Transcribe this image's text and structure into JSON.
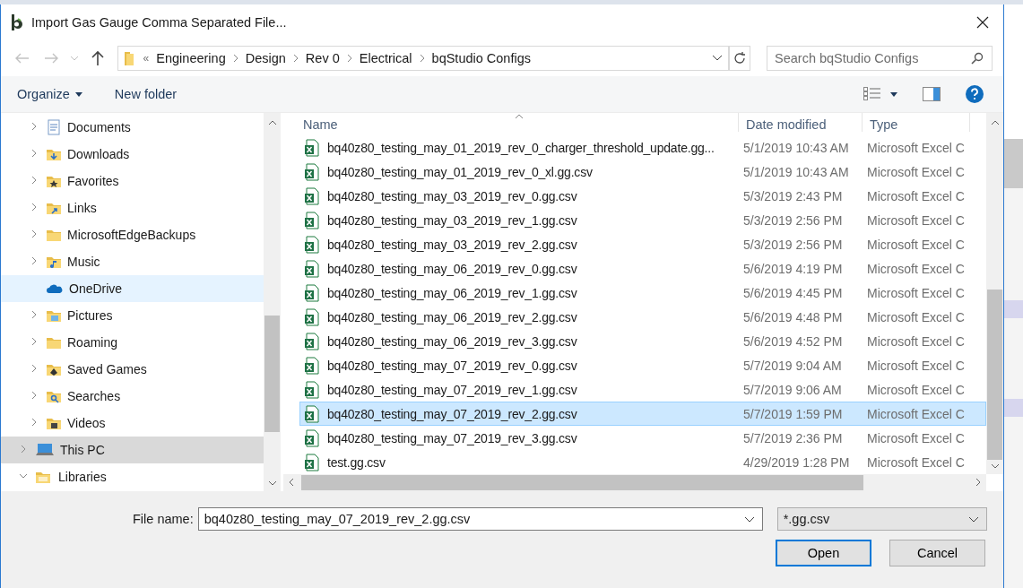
{
  "window": {
    "title": "Import Gas Gauge Comma Separated File..."
  },
  "address": {
    "overflow": "«",
    "crumbs": [
      "Engineering",
      "Design",
      "Rev 0",
      "Electrical",
      "bqStudio Configs"
    ]
  },
  "search": {
    "placeholder": "Search bqStudio Configs"
  },
  "toolbar": {
    "organize": "Organize",
    "new_folder": "New folder"
  },
  "nav": {
    "user_folders": [
      {
        "label": "Documents",
        "kind": "documents",
        "expandable": true,
        "expanded": false,
        "selected": false,
        "hovered": false
      },
      {
        "label": "Downloads",
        "kind": "downloads",
        "expandable": true,
        "expanded": false,
        "selected": false,
        "hovered": false
      },
      {
        "label": "Favorites",
        "kind": "favorites",
        "expandable": true,
        "expanded": false,
        "selected": false,
        "hovered": false
      },
      {
        "label": "Links",
        "kind": "links",
        "expandable": true,
        "expanded": false,
        "selected": false,
        "hovered": false
      },
      {
        "label": "MicrosoftEdgeBackups",
        "kind": "folder",
        "expandable": true,
        "expanded": false,
        "selected": false,
        "hovered": false
      },
      {
        "label": "Music",
        "kind": "music",
        "expandable": true,
        "expanded": false,
        "selected": false,
        "hovered": false
      },
      {
        "label": "OneDrive",
        "kind": "cloud",
        "expandable": false,
        "selected": false,
        "hovered": true
      },
      {
        "label": "Pictures",
        "kind": "pictures",
        "expandable": true,
        "expanded": false,
        "selected": false,
        "hovered": false
      },
      {
        "label": "Roaming",
        "kind": "folder",
        "expandable": true,
        "expanded": false,
        "selected": false,
        "hovered": false
      },
      {
        "label": "Saved Games",
        "kind": "games",
        "expandable": true,
        "expanded": false,
        "selected": false,
        "hovered": false
      },
      {
        "label": "Searches",
        "kind": "searches",
        "expandable": true,
        "expanded": false,
        "selected": false,
        "hovered": false
      },
      {
        "label": "Videos",
        "kind": "videos",
        "expandable": true,
        "expanded": false,
        "selected": false,
        "hovered": false
      }
    ],
    "roots": [
      {
        "label": "This PC",
        "kind": "pc",
        "expandable": true,
        "expanded": false,
        "selected": true,
        "hovered": false
      },
      {
        "label": "Libraries",
        "kind": "library",
        "expandable": true,
        "expanded": true,
        "selected": false,
        "hovered": false
      }
    ]
  },
  "files": {
    "columns": [
      "Name",
      "Date modified",
      "Type"
    ],
    "rows": [
      {
        "name": "bq40z80_testing_may_01_2019_rev_0_charger_threshold_update.gg...",
        "date": "5/1/2019 10:43 AM",
        "type": "Microsoft Excel C",
        "selected": false
      },
      {
        "name": "bq40z80_testing_may_01_2019_rev_0_xl.gg.csv",
        "date": "5/1/2019 10:43 AM",
        "type": "Microsoft Excel C",
        "selected": false
      },
      {
        "name": "bq40z80_testing_may_03_2019_rev_0.gg.csv",
        "date": "5/3/2019 2:43 PM",
        "type": "Microsoft Excel C",
        "selected": false
      },
      {
        "name": "bq40z80_testing_may_03_2019_rev_1.gg.csv",
        "date": "5/3/2019 2:56 PM",
        "type": "Microsoft Excel C",
        "selected": false
      },
      {
        "name": "bq40z80_testing_may_03_2019_rev_2.gg.csv",
        "date": "5/3/2019 2:56 PM",
        "type": "Microsoft Excel C",
        "selected": false
      },
      {
        "name": "bq40z80_testing_may_06_2019_rev_0.gg.csv",
        "date": "5/6/2019 4:19 PM",
        "type": "Microsoft Excel C",
        "selected": false
      },
      {
        "name": "bq40z80_testing_may_06_2019_rev_1.gg.csv",
        "date": "5/6/2019 4:45 PM",
        "type": "Microsoft Excel C",
        "selected": false
      },
      {
        "name": "bq40z80_testing_may_06_2019_rev_2.gg.csv",
        "date": "5/6/2019 4:48 PM",
        "type": "Microsoft Excel C",
        "selected": false
      },
      {
        "name": "bq40z80_testing_may_06_2019_rev_3.gg.csv",
        "date": "5/6/2019 4:52 PM",
        "type": "Microsoft Excel C",
        "selected": false
      },
      {
        "name": "bq40z80_testing_may_07_2019_rev_0.gg.csv",
        "date": "5/7/2019 9:04 AM",
        "type": "Microsoft Excel C",
        "selected": false
      },
      {
        "name": "bq40z80_testing_may_07_2019_rev_1.gg.csv",
        "date": "5/7/2019 9:06 AM",
        "type": "Microsoft Excel C",
        "selected": false
      },
      {
        "name": "bq40z80_testing_may_07_2019_rev_2.gg.csv",
        "date": "5/7/2019 1:59 PM",
        "type": "Microsoft Excel C",
        "selected": true
      },
      {
        "name": "bq40z80_testing_may_07_2019_rev_3.gg.csv",
        "date": "5/7/2019 2:36 PM",
        "type": "Microsoft Excel C",
        "selected": false
      },
      {
        "name": "test.gg.csv",
        "date": "4/29/2019 1:28 PM",
        "type": "Microsoft Excel C",
        "selected": false
      }
    ]
  },
  "footer": {
    "file_name_label": "File name:",
    "file_name": "bq40z80_testing_may_07_2019_rev_2.gg.csv",
    "filter": "*.gg.csv",
    "open": "Open",
    "cancel": "Cancel"
  }
}
